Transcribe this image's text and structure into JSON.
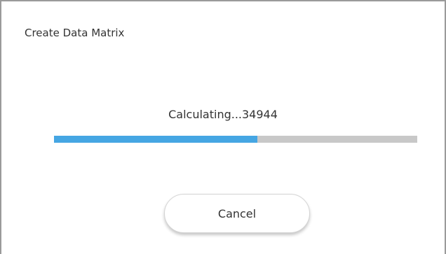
{
  "dialog": {
    "title": "Create Data Matrix",
    "status_text": "Calculating...34944",
    "progress": {
      "fraction": 0.56,
      "fill_color": "#45a6e3",
      "track_color": "#c8c8c8"
    },
    "cancel_label": "Cancel"
  }
}
